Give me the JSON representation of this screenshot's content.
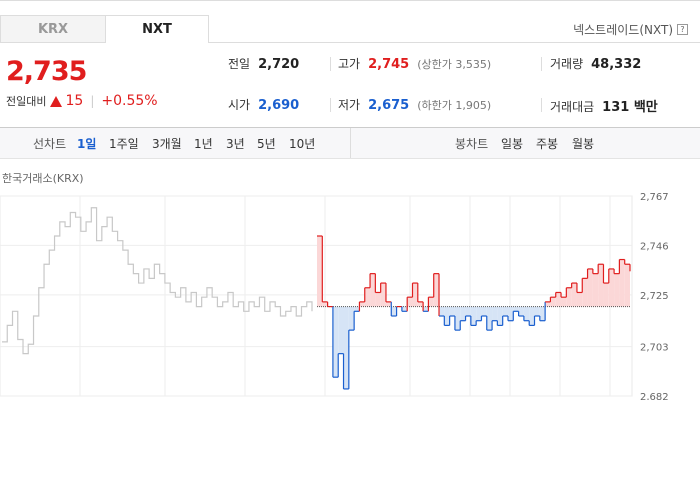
{
  "tabs": [
    {
      "label": "KRX"
    },
    {
      "label": "NXT"
    }
  ],
  "exchange_label": "넥스트레이드(NXT)",
  "help_icon_text": "?",
  "price": {
    "current": "2,735",
    "change_label": "전일대비",
    "change": "15",
    "change_pct": "+0.55%",
    "direction": "up"
  },
  "stats": {
    "prev_close": {
      "label": "전일",
      "value": "2,720"
    },
    "high": {
      "label": "고가",
      "value": "2,745",
      "sub": "(상한가 3,535)"
    },
    "volume": {
      "label": "거래량",
      "value": "48,332"
    },
    "open": {
      "label": "시가",
      "value": "2,690"
    },
    "low": {
      "label": "저가",
      "value": "2,675",
      "sub": "(하한가 1,905)"
    },
    "amount": {
      "label": "거래대금",
      "value": "131",
      "unit": "백만"
    }
  },
  "periods": {
    "line_label": "선차트",
    "line_items": [
      "1일",
      "1주일",
      "3개월",
      "1년",
      "3년",
      "5년",
      "10년"
    ],
    "active": "1일",
    "candle_label": "봉차트",
    "candle_items": [
      "일봉",
      "주봉",
      "월봉"
    ]
  },
  "chart_data": {
    "type": "line",
    "title": "한국거래소(KRX)",
    "yticks": [
      "2,767",
      "2,746",
      "2,725",
      "2,703",
      "2,682"
    ],
    "ylim": [
      2682,
      2767
    ],
    "baseline": 2720,
    "colors": {
      "krx": "#c8c8c8",
      "up": "#e01e1e",
      "down": "#1a5fcf",
      "up_fill": "#fbd7d7",
      "down_fill": "#d6e4f6"
    },
    "krx_series": [
      2705,
      2712,
      2718,
      2706,
      2700,
      2704,
      2716,
      2728,
      2738,
      2744,
      2750,
      2756,
      2754,
      2760,
      2758,
      2752,
      2756,
      2762,
      2748,
      2754,
      2758,
      2752,
      2748,
      2744,
      2738,
      2734,
      2730,
      2736,
      2732,
      2738,
      2734,
      2730,
      2726,
      2724,
      2728,
      2722,
      2726,
      2720,
      2724,
      2728,
      2724,
      2720,
      2722,
      2726,
      2720,
      2722,
      2718,
      2722,
      2720,
      2724,
      2718,
      2722,
      2720,
      2716,
      2718,
      2720,
      2716,
      2720,
      2722,
      2718
    ],
    "nxt_series": [
      2750,
      2722,
      2720,
      2690,
      2700,
      2685,
      2710,
      2718,
      2722,
      2728,
      2734,
      2726,
      2730,
      2722,
      2716,
      2720,
      2718,
      2724,
      2730,
      2722,
      2718,
      2724,
      2734,
      2716,
      2712,
      2716,
      2710,
      2714,
      2716,
      2712,
      2714,
      2716,
      2710,
      2714,
      2712,
      2716,
      2714,
      2718,
      2716,
      2714,
      2712,
      2716,
      2714,
      2722,
      2724,
      2726,
      2724,
      2728,
      2730,
      2726,
      2732,
      2736,
      2734,
      2738,
      2730,
      2736,
      2734,
      2740,
      2738,
      2735
    ]
  }
}
